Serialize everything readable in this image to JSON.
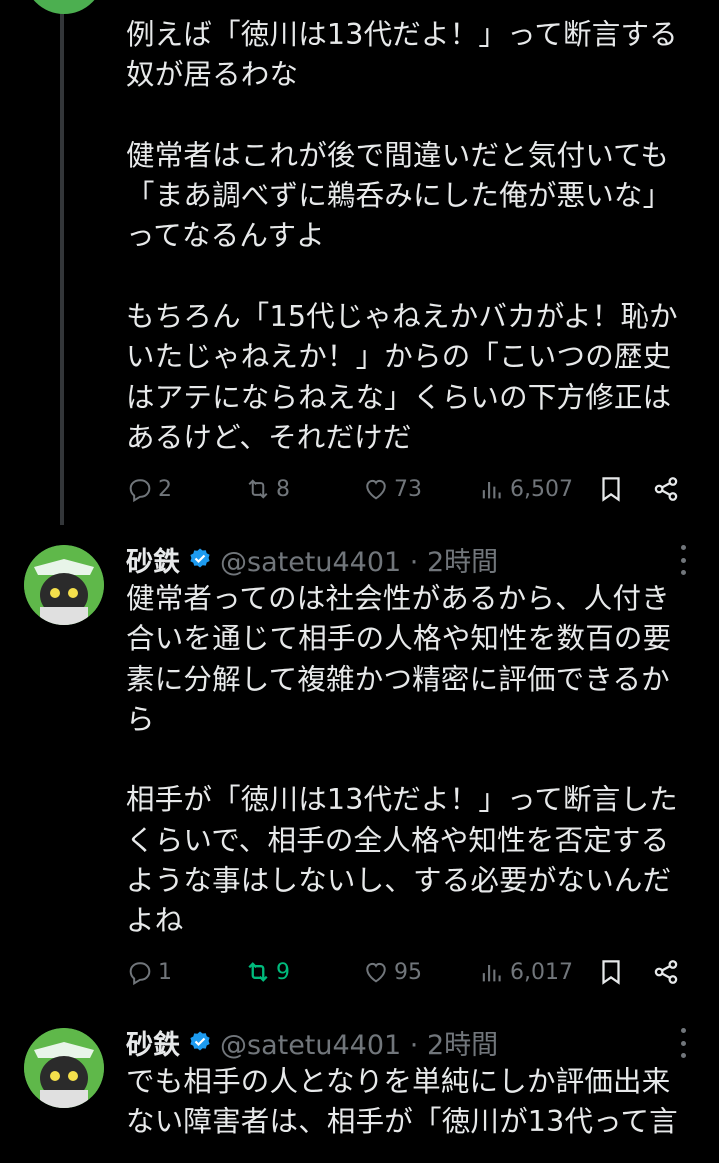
{
  "tweets": [
    {
      "body": "例えば「徳川は13代だよ！」って断言する\n奴が居るわな\n\n健常者はこれが後で間違いだと気付いても\n「まあ調べずに鵜呑みにした俺が悪いな」\nってなるんすよ\n\nもちろん「15代じゃねえかバカがよ！恥か\nいたじゃねえか！」からの「こいつの歴史\nはアテにならねえな」くらいの下方修正は\nあるけど、それだけだ",
      "replies": "2",
      "retweets": "8",
      "likes": "73",
      "views": "6,507"
    },
    {
      "name": "砂鉄",
      "handle": "@satetu4401 · 2時間",
      "body": "健常者ってのは社会性があるから、人付き\n合いを通じて相手の人格や知性を数百の要\n素に分解して複雑かつ精密に評価できるか\nら\n\n相手が「徳川は13代だよ！」って断言した\nくらいで、相手の全人格や知性を否定する\nような事はしないし、する必要がないんだ\nよね",
      "replies": "1",
      "retweets": "9",
      "likes": "95",
      "views": "6,017"
    },
    {
      "name": "砂鉄",
      "handle": "@satetu4401 · 2時間",
      "body": "でも相手の人となりを単純にしか評価出来\nない障害者は、相手が「徳川が13代って言"
    }
  ],
  "colors": {
    "background": "#000000",
    "text": "#e7e9ea",
    "muted": "#71767b",
    "retweet_active": "#00ba7c",
    "verified": "#1d9bf0",
    "avatar": "#4caf50"
  },
  "icons": [
    "reply-icon",
    "retweet-icon",
    "like-icon",
    "views-icon",
    "bookmark-icon",
    "share-icon",
    "verified-badge-icon",
    "more-icon"
  ]
}
